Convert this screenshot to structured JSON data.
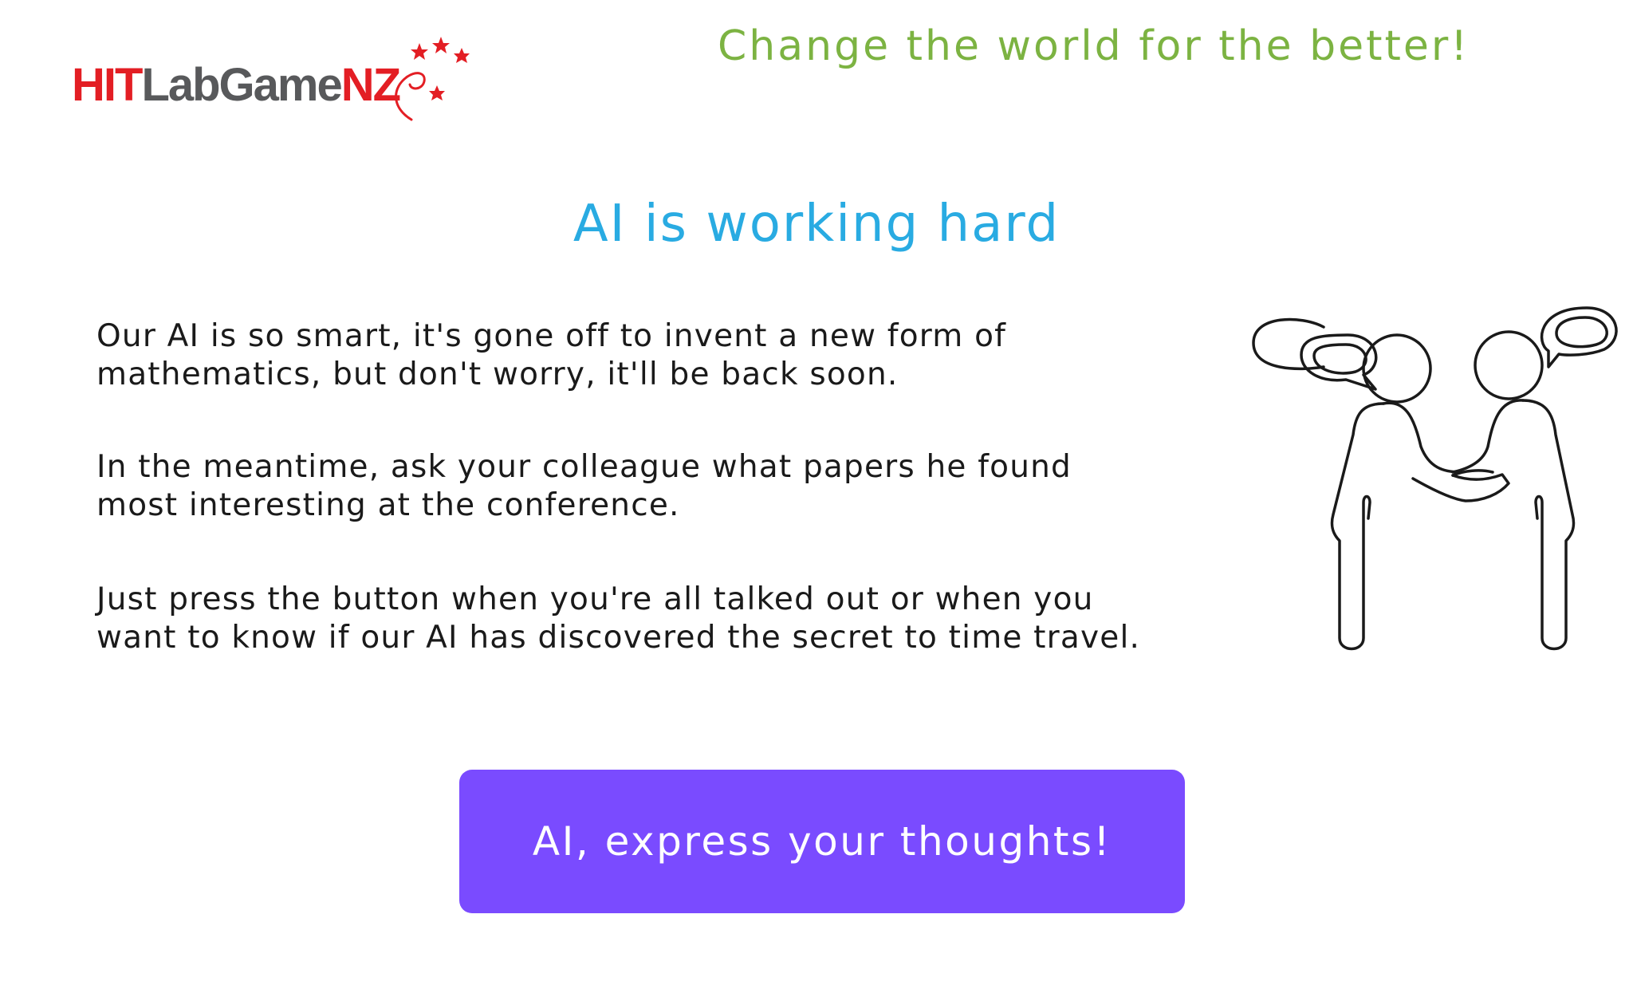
{
  "logo": {
    "text_red_1": "HIT",
    "text_gray": "LabGame",
    "text_red_2": "NZ",
    "brand_red": "#e31e24",
    "brand_gray": "#58595b"
  },
  "tagline": "Change the world for the better!",
  "heading": "AI is working hard",
  "paragraphs": [
    "Our AI is so smart, it's gone off to invent a new form of mathematics, but don't worry, it'll be back soon.",
    "In the meantime, ask your colleague what papers he found most interesting at the conference.",
    "Just press the button when you're all talked out or when you want to know if our AI has discovered the secret to time travel."
  ],
  "illustration": {
    "icon": "two-people-handshake-talking-icon"
  },
  "button": {
    "label": "AI, express your thoughts!",
    "color": "#7a4bff"
  },
  "colors": {
    "tagline": "#7cb342",
    "heading": "#29abe2",
    "body_text": "#1a1a1a"
  }
}
